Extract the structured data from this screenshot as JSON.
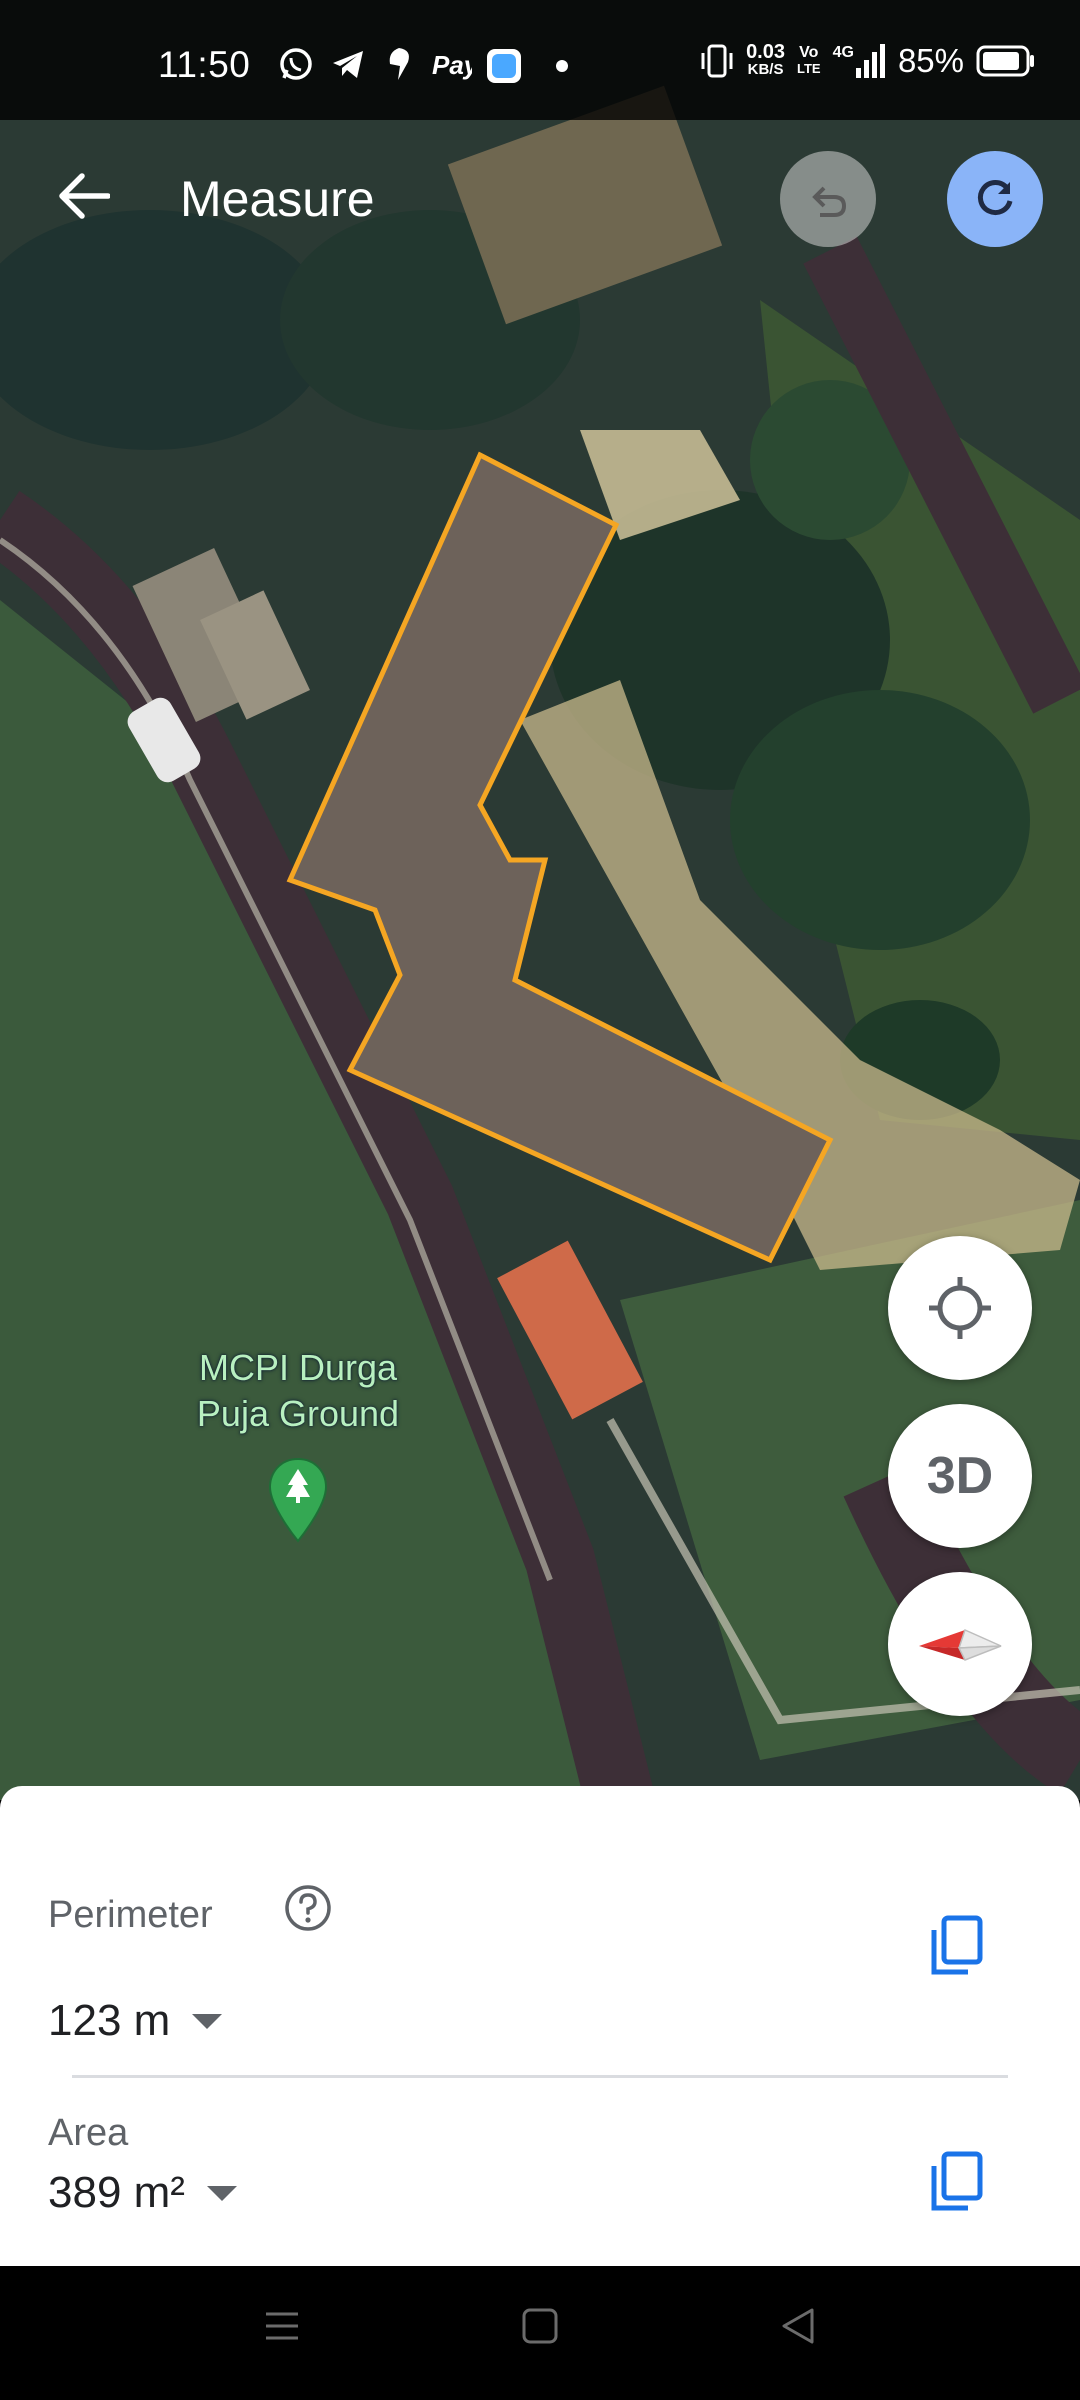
{
  "status_bar": {
    "time": "11:50",
    "net_speed_value": "0.03",
    "net_speed_unit": "KB/S",
    "volte_top": "Vo",
    "volte_bottom": "LTE",
    "network": "4G",
    "battery": "85%"
  },
  "header": {
    "title": "Measure",
    "back_icon": "arrow-back-icon",
    "undo_icon": "undo-icon",
    "redo_icon": "redo-icon"
  },
  "map": {
    "place_line1": "MCPI Durga",
    "place_line2": "Puja Ground",
    "pin_icon": "park-pin-icon",
    "measure_color": "#f5a623"
  },
  "controls": {
    "location_icon": "my-location-icon",
    "threed_label": "3D",
    "compass_icon": "compass-icon"
  },
  "sheet": {
    "perimeter_label": "Perimeter",
    "perimeter_value": "123 m",
    "area_label": "Area",
    "area_value": "389 m²",
    "copy_icon": "copy-icon",
    "help_icon": "help-icon",
    "accent": "#1a73e8"
  },
  "nav": {
    "menu_icon": "recents-icon",
    "home_icon": "home-icon",
    "back_icon": "nav-back-icon"
  }
}
